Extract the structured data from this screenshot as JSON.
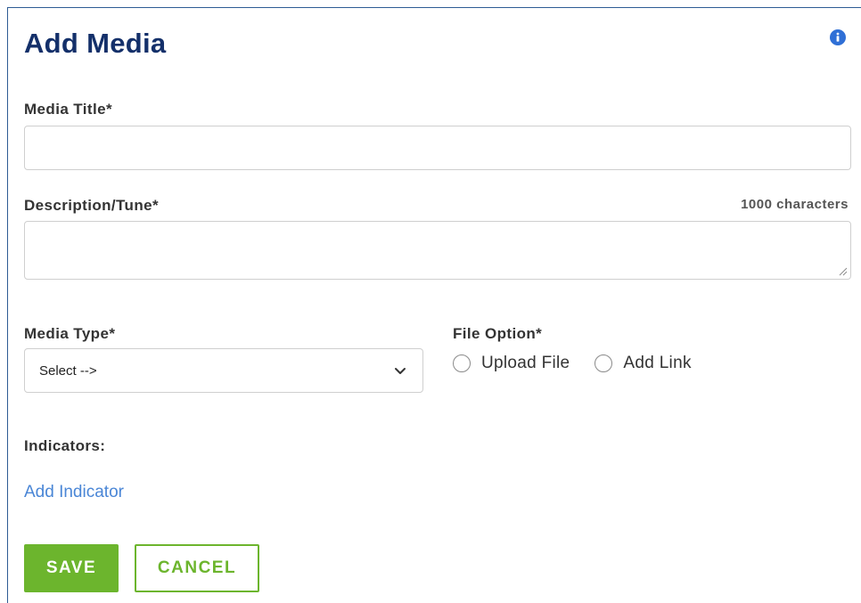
{
  "form": {
    "title": "Add Media",
    "info_icon": "info-circle-icon",
    "media_title": {
      "label": "Media Title*",
      "value": "",
      "placeholder": ""
    },
    "description": {
      "label": "Description/Tune*",
      "char_limit_text": "1000 characters",
      "value": "",
      "placeholder": ""
    },
    "media_type": {
      "label": "Media Type*",
      "selected": "Select -->"
    },
    "file_option": {
      "label": "File Option*",
      "options": [
        "Upload File",
        "Add Link"
      ],
      "selected": null
    },
    "indicators": {
      "label": "Indicators:",
      "add_link": "Add Indicator"
    },
    "buttons": {
      "save": "SAVE",
      "cancel": "CANCEL"
    }
  },
  "colors": {
    "title": "#14306a",
    "info_icon": "#2f6fd6",
    "link": "#4a86d6",
    "primary": "#6cb52d",
    "border_accent": "#2e5c94"
  }
}
